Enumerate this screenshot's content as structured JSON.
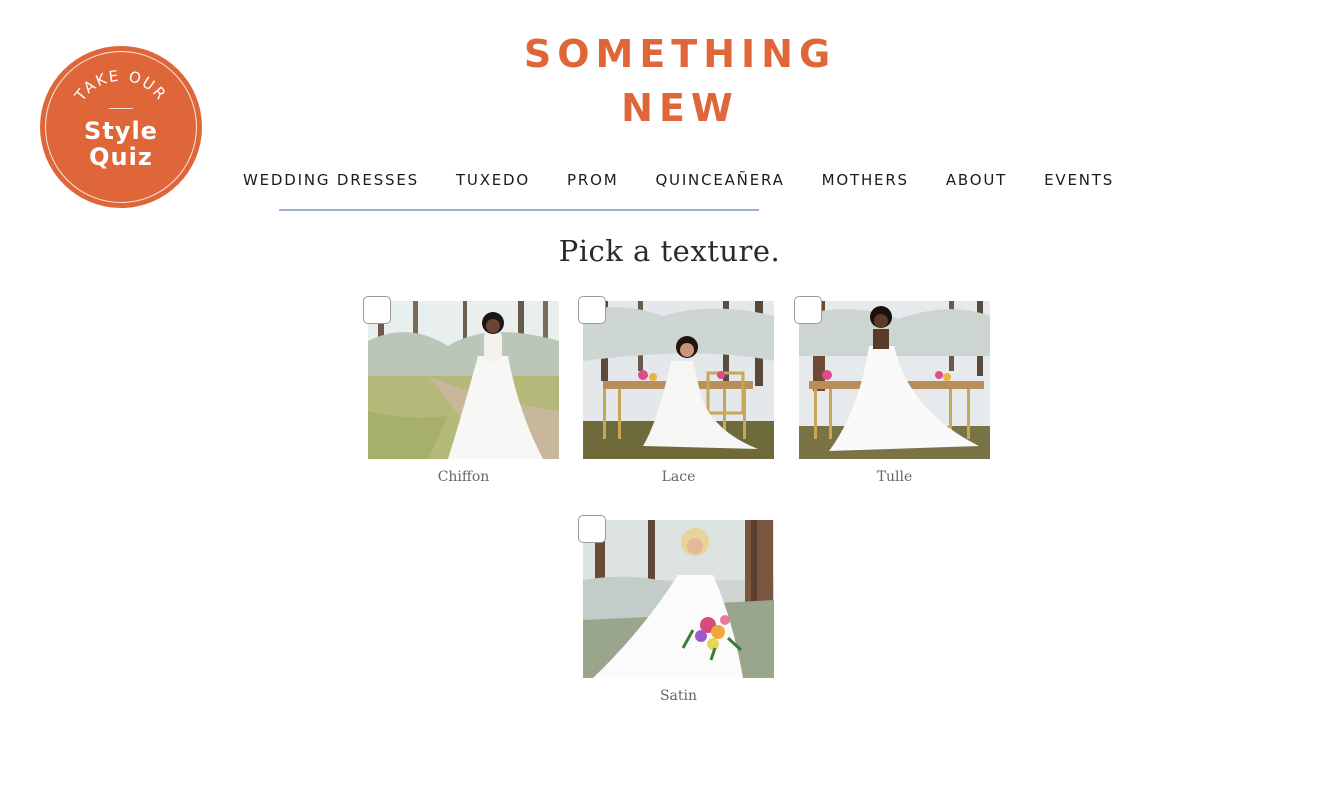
{
  "badge": {
    "top_text": "TAKE OUR",
    "line1": "Style",
    "line2": "Quiz"
  },
  "logo": {
    "line1": "SOMETHING",
    "line2": "NEW"
  },
  "nav": {
    "items": [
      {
        "label": "WEDDING DRESSES"
      },
      {
        "label": "TUXEDO"
      },
      {
        "label": "PROM"
      },
      {
        "label": "QUINCEAÑERA"
      },
      {
        "label": "MOTHERS"
      },
      {
        "label": "ABOUT"
      },
      {
        "label": "EVENTS"
      }
    ]
  },
  "quiz": {
    "question": "Pick a texture.",
    "options": [
      {
        "label": "Chiffon",
        "checked": false
      },
      {
        "label": "Lace",
        "checked": false
      },
      {
        "label": "Tulle",
        "checked": false
      },
      {
        "label": "Satin",
        "checked": false
      }
    ]
  },
  "colors": {
    "brand": "#df6639",
    "nav_underline": "#9cb4d3",
    "text": "#1b1b1b"
  }
}
